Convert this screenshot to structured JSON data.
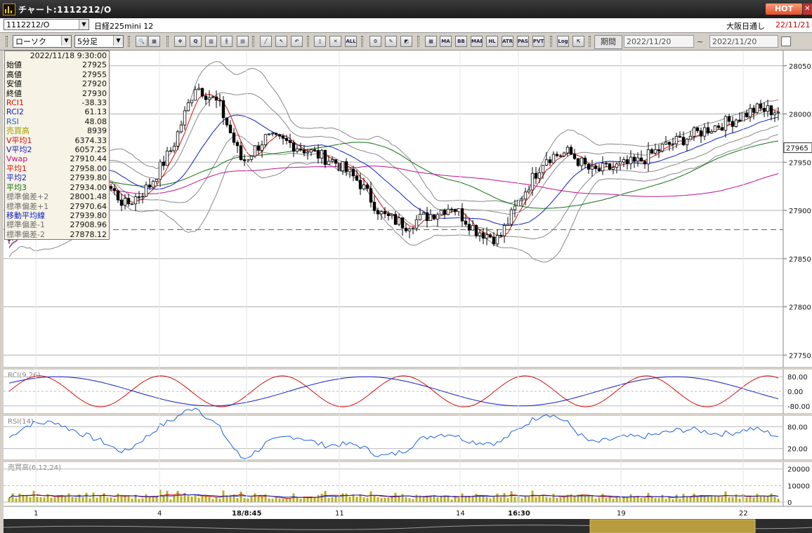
{
  "window": {
    "title": "チャート:1112212/O",
    "hot_label": "HOT",
    "close_glyph": "✕"
  },
  "header": {
    "symbol": "1112212/O",
    "instrument": "日経225mini 12",
    "session": "大阪日通し",
    "date": "22/11/21"
  },
  "toolbar": {
    "chart_type": "ローソク",
    "interval": "5分足",
    "period_label": "期間",
    "date_from": "2022/11/20",
    "date_to": "2022/11/20",
    "buttons": [
      {
        "name": "zoom-button",
        "label": "🔍"
      },
      {
        "name": "grid-button",
        "label": "▦"
      },
      {
        "name": "cursor-button",
        "label": "✥"
      },
      {
        "name": "find-button",
        "label": "Q"
      },
      {
        "name": "hist-button",
        "label": "▥"
      },
      {
        "name": "split-button",
        "label": "╫"
      },
      {
        "name": "print-button",
        "label": "▤"
      },
      {
        "name": "line-draw-button",
        "label": "╱"
      },
      {
        "name": "pointer-button",
        "label": "↖"
      },
      {
        "name": "undo-button",
        "label": "↶"
      },
      {
        "name": "candle-one-button",
        "label": "▯"
      },
      {
        "name": "candle-x-button",
        "label": "✕"
      },
      {
        "name": "all-button",
        "label": "ALL"
      },
      {
        "name": "settings-button",
        "label": "⚙"
      },
      {
        "name": "tools-button",
        "label": "✎"
      },
      {
        "name": "color-button",
        "label": "◩"
      },
      {
        "name": "indicator-button",
        "label": "▦"
      },
      {
        "name": "ma-button",
        "label": "MA"
      },
      {
        "name": "bb-button",
        "label": "BB"
      },
      {
        "name": "mae-button",
        "label": "MAE"
      },
      {
        "name": "hl-button",
        "label": "HL"
      },
      {
        "name": "atr-button",
        "label": "ATR"
      },
      {
        "name": "pas-button",
        "label": "PAS"
      },
      {
        "name": "pvt-button",
        "label": "PVT"
      },
      {
        "name": "log-button",
        "label": "Log"
      },
      {
        "name": "export-button",
        "label": "⇱"
      }
    ]
  },
  "info_panel": {
    "datetime": "2022/11/18 9:30:00",
    "rows": [
      {
        "label": "始値",
        "value": "27925",
        "color": "#000000"
      },
      {
        "label": "高値",
        "value": "27955",
        "color": "#000000"
      },
      {
        "label": "安値",
        "value": "27920",
        "color": "#000000"
      },
      {
        "label": "終値",
        "value": "27930",
        "color": "#000000"
      },
      {
        "label": "RCI1",
        "value": "-38.33",
        "color": "#d01010"
      },
      {
        "label": "RCI2",
        "value": "61.13",
        "color": "#1020c0"
      },
      {
        "label": "RSI",
        "value": "48.08",
        "color": "#1a60e0"
      },
      {
        "label": "売買高",
        "value": "8939",
        "color": "#a0a000"
      },
      {
        "label": "V平均1",
        "value": "6374.33",
        "color": "#d01010"
      },
      {
        "label": "V平均2",
        "value": "6057.25",
        "color": "#1020c0"
      },
      {
        "label": "Vwap",
        "value": "27910.44",
        "color": "#c01090"
      },
      {
        "label": "平均1",
        "value": "27958.00",
        "color": "#d01010"
      },
      {
        "label": "平均2",
        "value": "27939.80",
        "color": "#1020c0"
      },
      {
        "label": "平均3",
        "value": "27934.00",
        "color": "#107010"
      },
      {
        "label": "標準偏差+2",
        "value": "28001.48",
        "color": "#707070"
      },
      {
        "label": "標準偏差+1",
        "value": "27970.64",
        "color": "#707070"
      },
      {
        "label": "移動平均線",
        "value": "27939.80",
        "color": "#1020c0"
      },
      {
        "label": "標準偏差-1",
        "value": "27908.96",
        "color": "#707070"
      },
      {
        "label": "標準偏差-2",
        "value": "27878.12",
        "color": "#707070"
      }
    ]
  },
  "price_axis": {
    "ticks": [
      "28050",
      "28000",
      "27950",
      "27900",
      "27850",
      "27800",
      "27750"
    ],
    "current_price": "27965"
  },
  "rci_panel": {
    "label": "RCI(9,26)",
    "ticks": [
      "80.00",
      "0.00",
      "-80.00"
    ]
  },
  "rsi_panel": {
    "label": "RSI(14)",
    "ticks": [
      "80.00",
      "20.00"
    ]
  },
  "volume_panel": {
    "label": "売買高(6,12,24)",
    "ticks": [
      "20000",
      "10000",
      "0"
    ]
  },
  "time_axis": {
    "labels": [
      "1",
      "4",
      "18/8:45",
      "11",
      "14",
      "16:30",
      "19",
      "22"
    ]
  },
  "chart_data": {
    "type": "line",
    "title": "",
    "ylim": [
      27740,
      28060
    ],
    "reference_price": 27880,
    "candle_close_samples": [
      27870,
      27925,
      27960,
      27940,
      27932,
      27905,
      27925,
      27965,
      28030,
      28010,
      27950,
      27975,
      27970,
      27960,
      27950,
      27930,
      27895,
      27885,
      27895,
      27905,
      27880,
      27870,
      27915,
      27955,
      27960,
      27940,
      27945,
      27950,
      27965,
      27975,
      27985,
      27993,
      28005,
      28003
    ],
    "series": [
      {
        "name": "平均1",
        "color": "#d01010"
      },
      {
        "name": "平均2",
        "color": "#1020c0"
      },
      {
        "name": "平均3",
        "color": "#107010"
      },
      {
        "name": "Vwap",
        "color": "#c01090"
      }
    ],
    "volume_ylim": [
      0,
      22000
    ]
  }
}
